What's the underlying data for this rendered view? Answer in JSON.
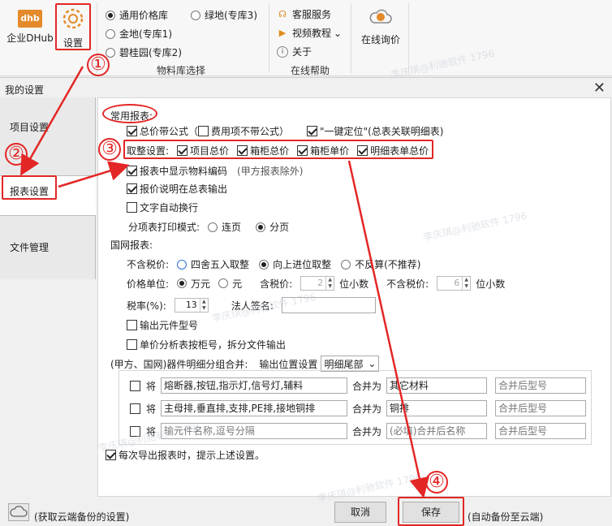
{
  "ribbon": {
    "btn_enterprise": "企业DHub",
    "btn_settings": "设置",
    "libs": [
      {
        "label": "通用价格库",
        "checked": true
      },
      {
        "label": "金地(专库1)",
        "checked": false
      },
      {
        "label": "碧桂园(专库2)",
        "checked": false
      },
      {
        "label": "绿地(专库3)",
        "checked": false
      }
    ],
    "lib_group_label": "物料库选择",
    "help": {
      "service": "客服服务",
      "video": "视频教程",
      "video_arrow": "⌄",
      "about": "关于",
      "group_label": "在线帮助"
    },
    "online_quote": "在线询价"
  },
  "dialog": {
    "title": "我的设置",
    "close": "✕",
    "sidebar": [
      "项目设置",
      "报表设置",
      "文件管理"
    ]
  },
  "form": {
    "section_common": "常用报表:",
    "total_formula": "总价带公式（",
    "fee_no_formula": "费用项不带公式）",
    "one_click": "\"一键定位\"(总表关联明细表)",
    "round_label": "取整设置:",
    "round_items": [
      "项目总价",
      "箱柜总价",
      "箱柜单价",
      "明细表单总价"
    ],
    "show_material_code": "报表中显示物料编码",
    "show_material_code_note": "(甲方报表除外)",
    "quote_note_total": "报价说明在总表输出",
    "auto_wrap": "文字自动换行",
    "print_mode_label": "分项表打印模式:",
    "print_mode_opts": [
      "连页",
      "分页"
    ],
    "section_grid": "国网报表:",
    "no_tax_label": "不含税价:",
    "no_tax_opts": [
      "四舍五入取整",
      "向上进位取整",
      "不反算(不推荐)"
    ],
    "price_unit_label": "价格单位:",
    "price_unit_opts": [
      "万元",
      "元"
    ],
    "tax_incl_label": "含税价:",
    "tax_incl_value": "2",
    "decimals": "位小数",
    "tax_excl_label": "不含税价:",
    "tax_excl_value": "6",
    "tax_rate_label": "税率(%):",
    "tax_rate_value": "13",
    "legal_sign_label": "法人签名:",
    "legal_sign_value": "",
    "output_model": "输出元件型号",
    "split_by_cabinet": "单价分析表按柜号，拆分文件输出",
    "merge_label": "(甲方、国网)器件明细分组合并:",
    "output_pos_label": "输出位置设置",
    "output_pos_value": "明细尾部",
    "merge_rows": [
      {
        "prefix": "将",
        "names": "熔断器,按钮,指示灯,信号灯,辅料",
        "merge_as": "合并为",
        "target": "其它材料",
        "model": "合并后型号",
        "ph_names": false
      },
      {
        "prefix": "将",
        "names": "主母排,垂直排,支排,PE排,接地铜排",
        "merge_as": "合并为",
        "target": "铜排",
        "model": "合并后型号",
        "ph_names": false
      },
      {
        "prefix": "将",
        "names": "输元件名称,逗号分隔",
        "merge_as": "合并为",
        "target": "(必填)合并后名称",
        "model": "合并后型号",
        "ph_names": true
      }
    ],
    "prompt_export": "每次导出报表时，提示上述设置。"
  },
  "footer": {
    "cloud_fetch": "(获取云端备份的设置)",
    "cancel": "取消",
    "save": "保存",
    "auto_backup": "(自动备份至云端)"
  },
  "annotations": {
    "n1": "①",
    "n2": "②",
    "n3": "③",
    "n4": "④"
  },
  "watermark": "李庆琪@利驰软件 1796",
  "colors": {
    "annotation": "#e32626",
    "accent": "#2f6fd6",
    "logo": "#e48a2a"
  }
}
